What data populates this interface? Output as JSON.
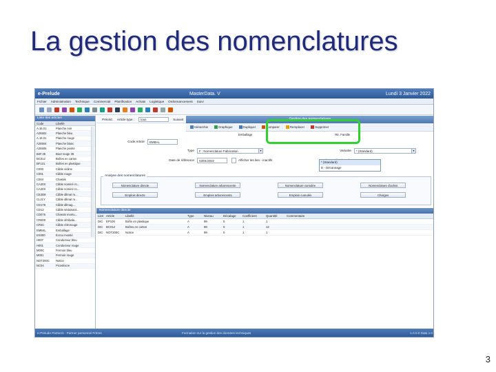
{
  "slide": {
    "title": "La gestion des nomenclatures",
    "page_number": "3"
  },
  "window": {
    "app_name": "e-Prelude",
    "module": "MasterData. V",
    "date": "Lundi 3 Janvier 2022"
  },
  "menu": [
    "Fichier",
    "Administration",
    "Technique",
    "Commercial",
    "Planification",
    "Achats",
    "Logistique",
    "Ordonnancement",
    "Suivi"
  ],
  "left_panel": {
    "title": "Liste des articles",
    "col_code": "Code",
    "col_label": "Libellé",
    "rows": [
      [
        "A.16.01",
        "Planche noir"
      ],
      [
        "A25502",
        "Planche bleu"
      ],
      [
        "A.16.01",
        "Planche rouge"
      ],
      [
        "A25504",
        "Planche blanc"
      ],
      [
        "A25505",
        "Planche peinte"
      ],
      [
        "B2F.35",
        "Bout rouge 35"
      ],
      [
        "BC012",
        "Boîtes en carton"
      ],
      [
        "BF131",
        "Boîtes en plastique"
      ],
      [
        "C000",
        "Câble violine"
      ],
      [
        "C001",
        "Câble rouge"
      ],
      [
        "C004",
        "Chassis"
      ],
      [
        "CA20X",
        "Câble nominé ro..."
      ],
      [
        "CA20X",
        "Câble nominé ro..."
      ],
      [
        "CE2D8",
        "Câble dilmat ro..."
      ],
      [
        "CL21Y",
        "Câble dilmat ro..."
      ],
      [
        "CD178",
        "Câble dilmag..."
      ],
      [
        "CD12",
        "Câble séduisant..."
      ],
      [
        "CD075",
        "Chassis montu..."
      ],
      [
        "CR000",
        "Câble déribala..."
      ],
      [
        "CR3C",
        "Câble rétrorouge"
      ],
      [
        "EMB4L",
        "Emballage"
      ],
      [
        "ES000",
        "Écrou montié"
      ],
      [
        "H007",
        "Conducteur bleu"
      ],
      [
        "H001",
        "Conducteur rouge"
      ],
      [
        "M00C",
        "Fermoir bleu"
      ],
      [
        "M001",
        "Fermoir rouge"
      ],
      [
        "NOT200C",
        "Notice"
      ],
      [
        "NC04",
        "Picosilocre"
      ]
    ]
  },
  "article_bar": {
    "prev": "Précéd.",
    "type_label": "Article type :",
    "type_value": "tous",
    "next": "Suivant"
  },
  "nomenclature": {
    "title": "Gestion des nomenclatures",
    "actions": [
      "Hiérarchie",
      "Graphique",
      "Dupliquer",
      "Comparer",
      "Remplacer",
      "Supprimer"
    ],
    "sub": [
      "Emballage",
      "Ré. Famille"
    ]
  },
  "form": {
    "code_label": "Code Article",
    "code_value": "EMBAL",
    "type_label": "Type",
    "type_value": "F : Nomenclature Fabrication",
    "variant_label": "Variante",
    "variant_value": "* (Standard)",
    "date_label": "Date de référence",
    "date_value": "03/01/2022",
    "checkbox_label": "Afficher les lien - inactifs",
    "variant_sel_label": "Variante sélectionnée",
    "variant_options": [
      "* (Standard)",
      "D - Décannage"
    ]
  },
  "analyse": {
    "title": "Analyse des nomenclatures",
    "buttons_row1": [
      "Nomenclature directe",
      "Nomenclature arborescente",
      "Nomenclature cumulée",
      "Nomenclature d'achat"
    ],
    "buttons_row2": [
      "Emplois directs",
      "Emplois arborescents",
      "Emplois cumulés",
      "Charges"
    ]
  },
  "nom_directe": {
    "title": "Nomenclature directe",
    "columns": [
      "Lien",
      "Article",
      "Libellé",
      "Type",
      "Niveau",
      "Décalage",
      "Coefficient",
      "Quantité",
      "Commentaire"
    ],
    "rows": [
      [
        "DIC",
        "EP100",
        "Boîte en plastique",
        "A",
        "99",
        "0",
        "1",
        "1",
        ""
      ],
      [
        "DIC",
        "BC012",
        "Boîtes en carton",
        "A",
        "99",
        "0",
        "1",
        "12",
        ""
      ],
      [
        "DIC",
        "NOT200C",
        "Notice",
        "A",
        "99",
        "0",
        "1",
        "1",
        ""
      ]
    ]
  },
  "status": {
    "left": "e-Prelude Partners - Partner personnel Frères",
    "mid": "Formation sur la gestion des données techniques",
    "right": "1.0.0.0 Data 1.0"
  },
  "colors": {
    "accent": "#2f5a98",
    "highlight": "#2ed12e",
    "title": "#1f2a7a"
  }
}
